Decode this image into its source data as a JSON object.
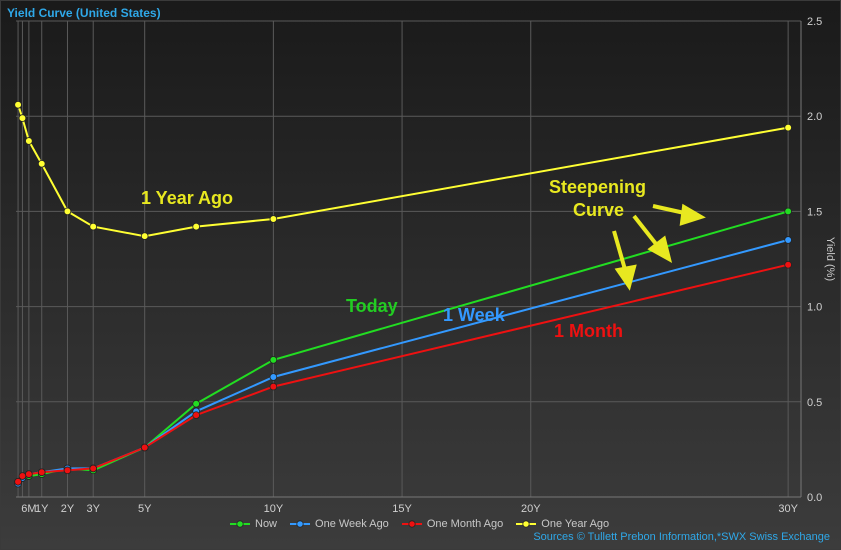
{
  "title": "Yield Curve (United States)",
  "sources": "Sources  © Tullett Prebon Information,*SWX Swiss Exchange",
  "colors": {
    "now": "#22dd22",
    "week": "#3399ff",
    "month": "#ee1111",
    "year": "#ffff33"
  },
  "annotations": {
    "year": "1 Year Ago",
    "today": "Today",
    "week": "1 Week",
    "month": "1 Month",
    "steep1": "Steepening",
    "steep2": "Curve"
  },
  "chart_data": {
    "type": "line",
    "title": "Yield Curve (United States)",
    "ylabel": "Yield (%)",
    "xlim": [
      0,
      30.5
    ],
    "ylim": [
      0,
      2.5
    ],
    "x_ticks": [
      {
        "label": "6M",
        "x": 0.5
      },
      {
        "label": "1Y",
        "x": 1
      },
      {
        "label": "2Y",
        "x": 2
      },
      {
        "label": "3Y",
        "x": 3
      },
      {
        "label": "5Y",
        "x": 5
      },
      {
        "label": "10Y",
        "x": 10
      },
      {
        "label": "15Y",
        "x": 15
      },
      {
        "label": "20Y",
        "x": 20
      },
      {
        "label": "30Y",
        "x": 30
      }
    ],
    "y_ticks": [
      "0.0",
      "0.5",
      "1.0",
      "1.5",
      "2.0",
      "2.5"
    ],
    "vgrid": [
      0.08,
      0.25,
      0.5,
      1,
      2,
      3,
      5,
      10,
      15,
      20,
      30
    ],
    "legend_position": "bottom",
    "series": [
      {
        "name": "Now",
        "key": "now",
        "x": [
          0.08,
          0.25,
          0.5,
          1,
          2,
          3,
          5,
          7,
          10,
          30
        ],
        "y": [
          0.08,
          0.1,
          0.11,
          0.12,
          0.15,
          0.14,
          0.26,
          0.49,
          0.72,
          1.5
        ]
      },
      {
        "name": "One Week Ago",
        "key": "week",
        "x": [
          0.08,
          0.25,
          0.5,
          1,
          2,
          3,
          5,
          7,
          10,
          30
        ],
        "y": [
          0.07,
          0.1,
          0.12,
          0.13,
          0.15,
          0.15,
          0.26,
          0.45,
          0.63,
          1.35
        ]
      },
      {
        "name": "One Month Ago",
        "key": "month",
        "x": [
          0.08,
          0.25,
          0.5,
          1,
          2,
          3,
          5,
          7,
          10,
          30
        ],
        "y": [
          0.08,
          0.11,
          0.12,
          0.13,
          0.14,
          0.15,
          0.26,
          0.43,
          0.58,
          1.22
        ]
      },
      {
        "name": "One Year Ago",
        "key": "year",
        "x": [
          0.08,
          0.25,
          0.5,
          1,
          2,
          3,
          5,
          7,
          10,
          30
        ],
        "y": [
          2.06,
          1.99,
          1.87,
          1.75,
          1.5,
          1.42,
          1.37,
          1.42,
          1.46,
          1.94
        ]
      }
    ]
  }
}
